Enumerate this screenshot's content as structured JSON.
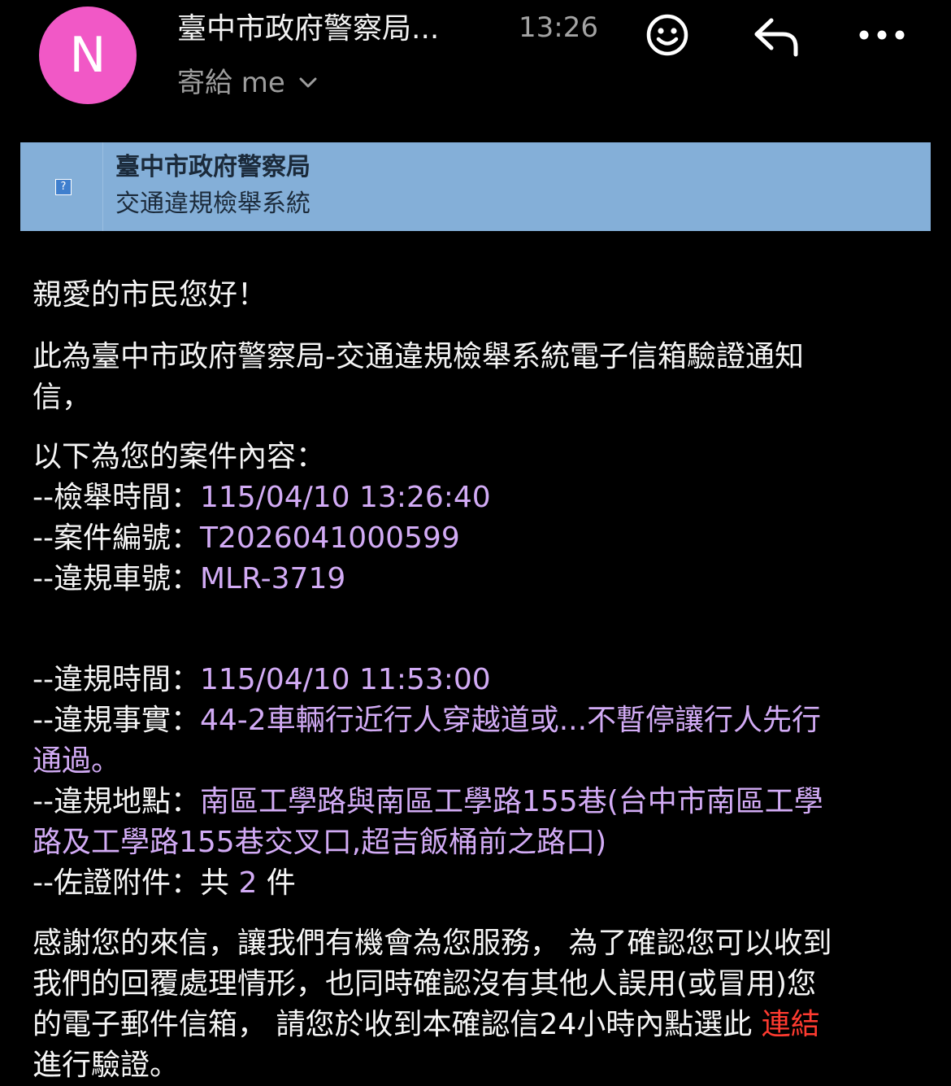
{
  "header": {
    "avatar_letter": "N",
    "sender": "臺中市政府警察局...",
    "time": "13:26",
    "recipient": "寄給 me",
    "icons": [
      "emoji-icon",
      "reply-icon",
      "more-icon"
    ]
  },
  "banner": {
    "title": "臺中市政府警察局",
    "subtitle": "交通違規檢舉系統",
    "image_placeholder": "?"
  },
  "message": {
    "greeting": "親愛的市民您好！",
    "intro_line1": "此為臺中市政府警察局-交通違規檢舉系統電子信箱驗證通知",
    "intro_line2": "信，",
    "case_heading": "以下為您的案件內容：",
    "report_time_label": "--檢舉時間：",
    "report_time_value": "115/04/10 13:26:40",
    "case_no_label": "--案件編號：",
    "case_no_value": "T2026041000599",
    "plate_label": "--違規車號：",
    "plate_value": "MLR-3719",
    "violation_time_label": "--違規時間：",
    "violation_time_value": "115/04/10 11:53:00",
    "fact_label": "--違規事實：",
    "fact_value_line1": "44-2車輛行近行人穿越道或...不暫停讓行人先行",
    "fact_value_line2": "通過。",
    "place_label": "--違規地點：",
    "place_value_line1": "南區工學路與南區工學路155巷(台中市南區工學",
    "place_value_line2": "路及工學路155巷交叉口,超吉飯桶前之路口)",
    "attachments_label": "--佐證附件：",
    "attachments_prefix": "共 ",
    "attachments_count": "2",
    "attachments_suffix": " 件",
    "closing_line1": "感謝您的來信，讓我們有機會為您服務， 為了確認您可以收到",
    "closing_line2": "我們的回覆處理情形，也同時確認沒有其他人誤用(或冒用)您",
    "closing_line3_prefix": "的電子郵件信箱， 請您於收到本確認信24小時內點選此 ",
    "link_text": "連結",
    "closing_line4": "進行驗證。"
  },
  "colors": {
    "avatar": "#f158c6",
    "banner": "#84afd8",
    "highlight": "#d2abf5",
    "link": "#ff3b30"
  }
}
